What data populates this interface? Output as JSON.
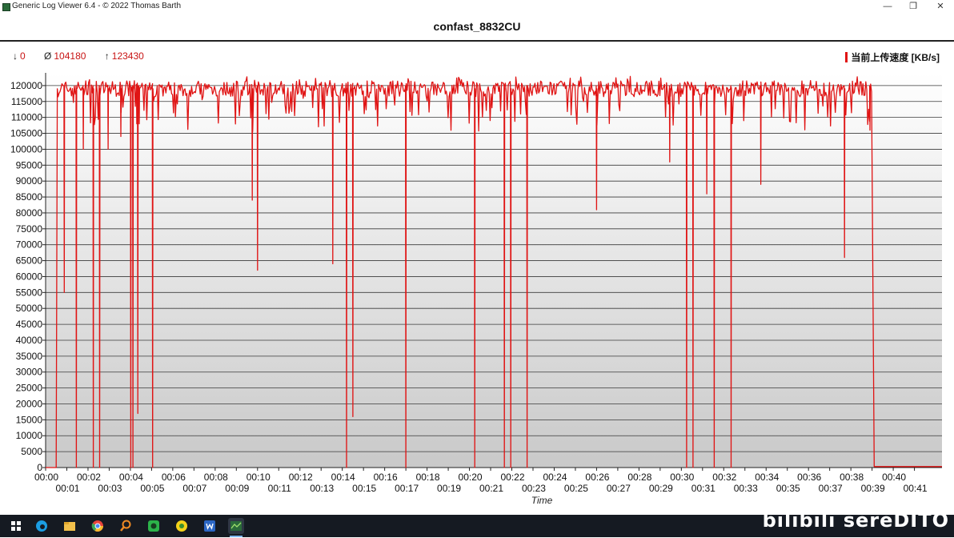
{
  "window": {
    "title": "Generic Log Viewer 6.4 - © 2022 Thomas Barth",
    "minimize": "—",
    "maximize": "❐",
    "close": "✕"
  },
  "header": {
    "title": "confast_8832CU"
  },
  "stats": {
    "min_symbol": "↓",
    "min": "0",
    "avg_symbol": "Ø",
    "avg": "104180",
    "max_symbol": "↑",
    "max": "123430"
  },
  "taskbar": {
    "icons": [
      "windows-start-icon",
      "edge-icon",
      "file-explorer-icon",
      "chrome-icon",
      "search-app-icon",
      "green-app-icon",
      "yellow-app-icon",
      "word-icon",
      "log-viewer-icon"
    ]
  },
  "watermark": {
    "text": "bilibili sereDITO"
  },
  "colors": {
    "series": "#e01414",
    "stats": "#c81414"
  },
  "chart_data": {
    "type": "line",
    "title": "confast_8832CU",
    "xlabel": "Time",
    "ylabel": "",
    "legend": "当前上传速度 [KB/s]",
    "legend_position": "top-right",
    "ylim": [
      0,
      124000
    ],
    "xlim_minutes": [
      0,
      42.3
    ],
    "y_ticks": [
      0,
      5000,
      10000,
      15000,
      20000,
      25000,
      30000,
      35000,
      40000,
      45000,
      50000,
      55000,
      60000,
      65000,
      70000,
      75000,
      80000,
      85000,
      90000,
      95000,
      100000,
      105000,
      110000,
      115000,
      120000
    ],
    "x_ticks": [
      "00:00",
      "00:01",
      "00:02",
      "00:03",
      "00:04",
      "00:05",
      "00:06",
      "00:07",
      "00:08",
      "00:09",
      "00:10",
      "00:11",
      "00:12",
      "00:13",
      "00:14",
      "00:15",
      "00:16",
      "00:17",
      "00:18",
      "00:19",
      "00:20",
      "00:21",
      "00:22",
      "00:23",
      "00:24",
      "00:25",
      "00:26",
      "00:27",
      "00:28",
      "00:29",
      "00:30",
      "00:31",
      "00:32",
      "00:33",
      "00:34",
      "00:35",
      "00:36",
      "00:37",
      "00:38",
      "00:39",
      "00:40",
      "00:41"
    ],
    "grid": true,
    "series": [
      {
        "name": "当前上传速度 [KB/s]",
        "baseline": {
          "x": [
            0.0,
            0.5
          ],
          "y": 0
        },
        "plateau_level": 119000,
        "plateau_range_minutes": [
          0.55,
          39.0
        ],
        "end_drop_minutes": 39.1,
        "tail_level": 300,
        "dips": [
          {
            "t": 0.88,
            "v": 55000
          },
          {
            "t": 1.45,
            "v": 0
          },
          {
            "t": 1.78,
            "v": 100000
          },
          {
            "t": 2.25,
            "v": 0
          },
          {
            "t": 2.55,
            "v": 0
          },
          {
            "t": 2.95,
            "v": 100000
          },
          {
            "t": 3.55,
            "v": 104000
          },
          {
            "t": 4.02,
            "v": 0
          },
          {
            "t": 4.12,
            "v": 0
          },
          {
            "t": 4.3,
            "v": 108000
          },
          {
            "t": 4.35,
            "v": 17000
          },
          {
            "t": 4.42,
            "v": 108000
          },
          {
            "t": 5.05,
            "v": 0
          },
          {
            "t": 9.75,
            "v": 84000
          },
          {
            "t": 10.0,
            "v": 62000
          },
          {
            "t": 13.55,
            "v": 64000
          },
          {
            "t": 14.2,
            "v": 0
          },
          {
            "t": 14.5,
            "v": 16000
          },
          {
            "t": 17.0,
            "v": 0
          },
          {
            "t": 20.25,
            "v": 0
          },
          {
            "t": 21.65,
            "v": 0
          },
          {
            "t": 21.95,
            "v": 0
          },
          {
            "t": 22.72,
            "v": 0
          },
          {
            "t": 26.0,
            "v": 81000
          },
          {
            "t": 29.45,
            "v": 96000
          },
          {
            "t": 30.25,
            "v": 0
          },
          {
            "t": 30.55,
            "v": 0
          },
          {
            "t": 31.2,
            "v": 86000
          },
          {
            "t": 31.55,
            "v": 0
          },
          {
            "t": 32.35,
            "v": 0
          },
          {
            "t": 33.75,
            "v": 89000
          },
          {
            "t": 37.7,
            "v": 66000
          },
          {
            "t": 38.9,
            "v": 106000
          }
        ]
      }
    ]
  }
}
